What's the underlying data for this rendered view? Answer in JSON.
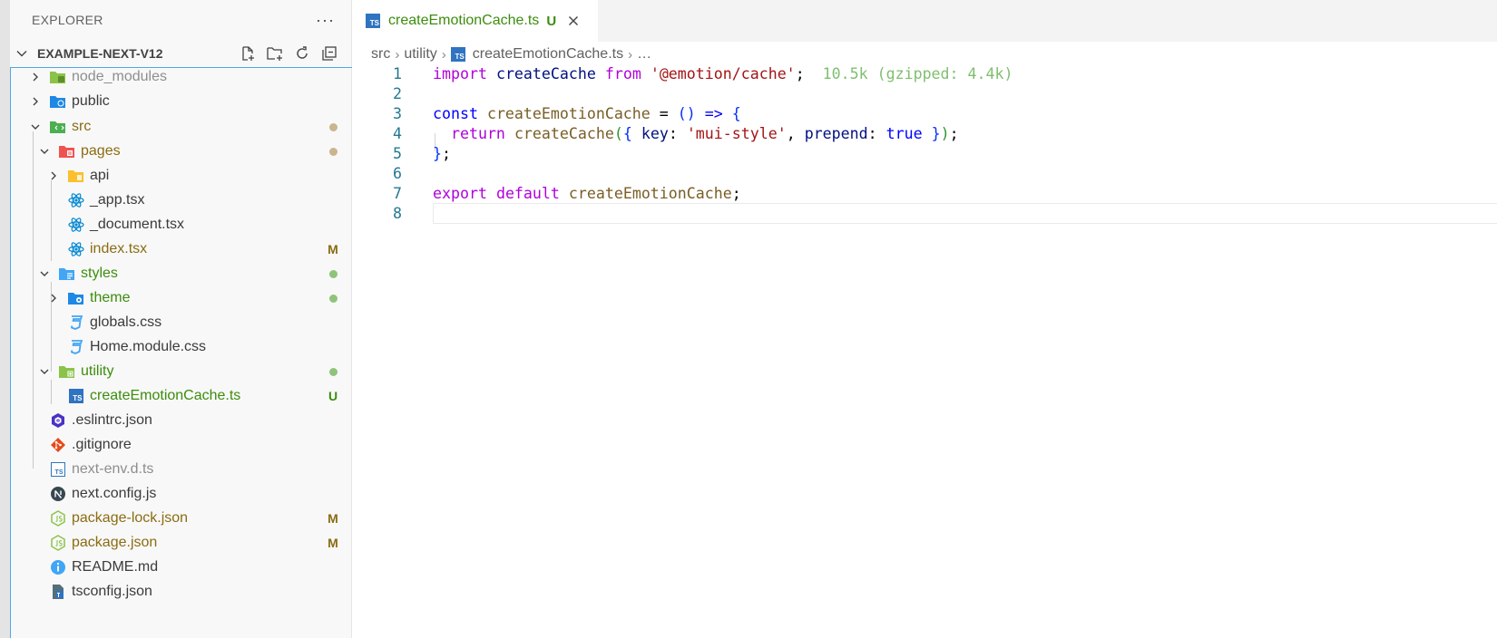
{
  "sidebar": {
    "header": "EXPLORER",
    "more_label": "···",
    "project_name": "EXAMPLE-NEXT-V12",
    "tree": [
      {
        "label": "node_modules",
        "status": ""
      },
      {
        "label": "public",
        "status": ""
      },
      {
        "label": "src",
        "status": ""
      },
      {
        "label": "pages",
        "status": ""
      },
      {
        "label": "api",
        "status": ""
      },
      {
        "label": "_app.tsx",
        "status": ""
      },
      {
        "label": "_document.tsx",
        "status": ""
      },
      {
        "label": "index.tsx",
        "status": "M"
      },
      {
        "label": "styles",
        "status": ""
      },
      {
        "label": "theme",
        "status": ""
      },
      {
        "label": "globals.css",
        "status": ""
      },
      {
        "label": "Home.module.css",
        "status": ""
      },
      {
        "label": "utility",
        "status": ""
      },
      {
        "label": "createEmotionCache.ts",
        "status": "U"
      },
      {
        "label": ".eslintrc.json",
        "status": ""
      },
      {
        "label": ".gitignore",
        "status": ""
      },
      {
        "label": "next-env.d.ts",
        "status": ""
      },
      {
        "label": "next.config.js",
        "status": ""
      },
      {
        "label": "package-lock.json",
        "status": "M"
      },
      {
        "label": "package.json",
        "status": "M"
      },
      {
        "label": "README.md",
        "status": ""
      },
      {
        "label": "tsconfig.json",
        "status": ""
      }
    ]
  },
  "editor": {
    "tab": {
      "title": "createEmotionCache.ts",
      "status": "U",
      "icon_text": "TS"
    },
    "breadcrumb": {
      "part1": "src",
      "part2": "utility",
      "file": "createEmotionCache.ts",
      "ellipsis": "…"
    },
    "line_numbers": [
      "1",
      "2",
      "3",
      "4",
      "5",
      "6",
      "7",
      "8"
    ],
    "code": {
      "l1_import": "import",
      "l1_name": "createCache",
      "l1_from": "from",
      "l1_module": "'@emotion/cache'",
      "l1_semi": ";",
      "l1_hint": "10.5k (gzipped: 4.4k)",
      "l3_const": "const",
      "l3_name": "createEmotionCache",
      "l3_eq": " = ",
      "l3_parens": "()",
      "l3_arrow": " => ",
      "l3_brace": "{",
      "l4_return": "return",
      "l4_fn": "createCache",
      "l4_paren_open": "(",
      "l4_brace_open": "{",
      "l4_key": "key",
      "l4_colon1": ": ",
      "l4_value": "'mui-style'",
      "l4_comma": ", ",
      "l4_prepend": "prepend",
      "l4_colon2": ": ",
      "l4_true": "true",
      "l4_brace_close": "}",
      "l4_paren_close": ")",
      "l4_semi": ";",
      "l5_close": "}",
      "l5_semi": ";",
      "l7_export": "export",
      "l7_default": "default",
      "l7_name": "createEmotionCache",
      "l7_semi": ";"
    }
  },
  "colors": {
    "modified": "#8a6c12",
    "untracked": "#3c8d0d",
    "dot_modified": "#c9b58f",
    "dot_untracked": "#8fc37a",
    "focus_border": "#4fa8e8"
  }
}
